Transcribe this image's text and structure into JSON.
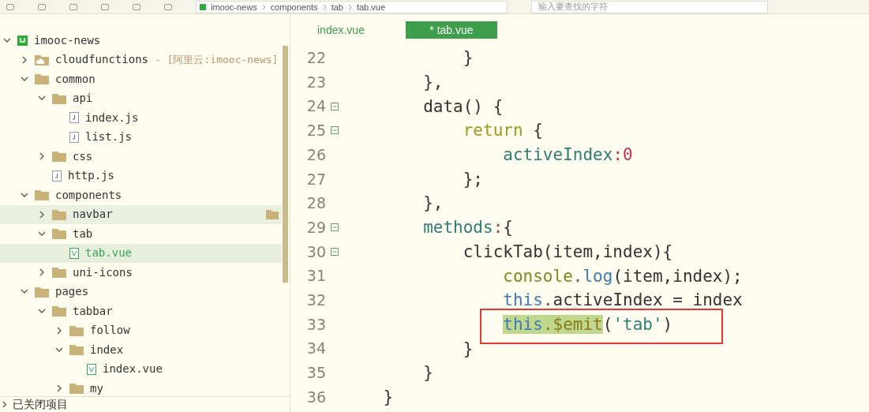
{
  "toolbar": {
    "breadcrumb": [
      "imooc-news",
      "components",
      "tab",
      "tab.vue"
    ],
    "search": {
      "placeholder": "输入要查找的字符"
    }
  },
  "explorer": {
    "tree": [
      {
        "label": "imooc-news",
        "kind": "project",
        "expanded": true,
        "selected": false,
        "hovered": false,
        "children": [
          {
            "label": "cloudfunctions",
            "suffix": "- [阿里云:imooc-news]",
            "kind": "cloud-folder",
            "expanded": false,
            "selected": false,
            "hovered": false
          },
          {
            "label": "common",
            "kind": "folder",
            "expanded": true,
            "selected": false,
            "hovered": false,
            "children": [
              {
                "label": "api",
                "kind": "folder",
                "expanded": true,
                "selected": false,
                "hovered": false,
                "children": [
                  {
                    "label": "index.js",
                    "kind": "js",
                    "selected": false,
                    "hovered": false
                  },
                  {
                    "label": "list.js",
                    "kind": "js",
                    "selected": false,
                    "hovered": false
                  }
                ]
              },
              {
                "label": "css",
                "kind": "folder",
                "expanded": false,
                "selected": false,
                "hovered": false
              },
              {
                "label": "http.js",
                "kind": "js",
                "selected": false,
                "hovered": false
              }
            ]
          },
          {
            "label": "components",
            "kind": "folder",
            "expanded": true,
            "selected": false,
            "hovered": false,
            "children": [
              {
                "label": "navbar",
                "kind": "folder",
                "expanded": false,
                "selected": false,
                "hovered": true
              },
              {
                "label": "tab",
                "kind": "folder",
                "expanded": true,
                "selected": false,
                "hovered": false,
                "children": [
                  {
                    "label": "tab.vue",
                    "kind": "vue",
                    "selected": true,
                    "hovered": false
                  }
                ]
              },
              {
                "label": "uni-icons",
                "kind": "folder",
                "expanded": false,
                "selected": false,
                "hovered": false
              }
            ]
          },
          {
            "label": "pages",
            "kind": "folder",
            "expanded": true,
            "selected": false,
            "hovered": false,
            "children": [
              {
                "label": "tabbar",
                "kind": "folder",
                "expanded": true,
                "selected": false,
                "hovered": false,
                "children": [
                  {
                    "label": "follow",
                    "kind": "folder",
                    "expanded": false,
                    "selected": false,
                    "hovered": false
                  },
                  {
                    "label": "index",
                    "kind": "folder",
                    "expanded": true,
                    "selected": false,
                    "hovered": false,
                    "children": [
                      {
                        "label": "index.vue",
                        "kind": "vue",
                        "selected": false,
                        "hovered": false
                      }
                    ]
                  },
                  {
                    "label": "my",
                    "kind": "folder",
                    "expanded": false,
                    "selected": false,
                    "hovered": false
                  }
                ]
              }
            ]
          }
        ]
      }
    ],
    "closed_projects": "已关闭项目"
  },
  "editor": {
    "tabs": [
      {
        "label": "index.vue",
        "selected": false
      },
      {
        "label": "* tab.vue",
        "selected": true
      }
    ],
    "lines": [
      {
        "number": "22",
        "fold": false,
        "boxed": false,
        "tokens": [
          {
            "text": "            }",
            "kind": "plain"
          }
        ]
      },
      {
        "number": "23",
        "fold": false,
        "boxed": false,
        "tokens": [
          {
            "text": "        },",
            "kind": "plain"
          }
        ]
      },
      {
        "number": "24",
        "fold": true,
        "boxed": false,
        "tokens": [
          {
            "text": "        data() {",
            "kind": "plain"
          }
        ]
      },
      {
        "number": "25",
        "fold": true,
        "boxed": false,
        "tokens": [
          {
            "text": "            return",
            "kind": "keyword"
          },
          {
            "text": " {",
            "kind": "plain"
          }
        ]
      },
      {
        "number": "26",
        "fold": false,
        "boxed": false,
        "tokens": [
          {
            "text": "                activeIndex",
            "kind": "property"
          },
          {
            "text": ":",
            "kind": "operator"
          },
          {
            "text": "0",
            "kind": "number"
          }
        ]
      },
      {
        "number": "27",
        "fold": false,
        "boxed": false,
        "tokens": [
          {
            "text": "            };",
            "kind": "plain"
          }
        ]
      },
      {
        "number": "28",
        "fold": false,
        "boxed": false,
        "tokens": [
          {
            "text": "        },",
            "kind": "plain"
          }
        ]
      },
      {
        "number": "29",
        "fold": true,
        "boxed": false,
        "tokens": [
          {
            "text": "        methods",
            "kind": "property"
          },
          {
            "text": ":",
            "kind": "operator"
          },
          {
            "text": "{",
            "kind": "plain"
          }
        ]
      },
      {
        "number": "30",
        "fold": true,
        "boxed": false,
        "tokens": [
          {
            "text": "            clickTab(item,index){",
            "kind": "plain"
          }
        ]
      },
      {
        "number": "31",
        "fold": false,
        "boxed": false,
        "tokens": [
          {
            "text": "                console",
            "kind": "object"
          },
          {
            "text": ".",
            "kind": "operator"
          },
          {
            "text": "log",
            "kind": "this"
          },
          {
            "text": "(item,index);",
            "kind": "plain"
          }
        ]
      },
      {
        "number": "32",
        "fold": false,
        "boxed": false,
        "tokens": [
          {
            "text": "                this",
            "kind": "this"
          },
          {
            "text": ".",
            "kind": "operator"
          },
          {
            "text": "activeIndex = index",
            "kind": "plain"
          }
        ]
      },
      {
        "number": "33",
        "fold": false,
        "boxed": true,
        "tokens": [
          {
            "text": "                this",
            "kind": "this-selected"
          },
          {
            "text": ".$emit",
            "kind": "object-selected"
          },
          {
            "text": "(",
            "kind": "plain"
          },
          {
            "text": "'tab'",
            "kind": "string"
          },
          {
            "text": ")",
            "kind": "plain"
          }
        ]
      },
      {
        "number": "34",
        "fold": false,
        "boxed": false,
        "tokens": [
          {
            "text": "            }",
            "kind": "plain"
          }
        ]
      },
      {
        "number": "35",
        "fold": false,
        "boxed": false,
        "tokens": [
          {
            "text": "        }",
            "kind": "plain"
          }
        ]
      },
      {
        "number": "36",
        "fold": false,
        "boxed": false,
        "tokens": [
          {
            "text": "    }",
            "kind": "plain"
          }
        ]
      }
    ]
  }
}
